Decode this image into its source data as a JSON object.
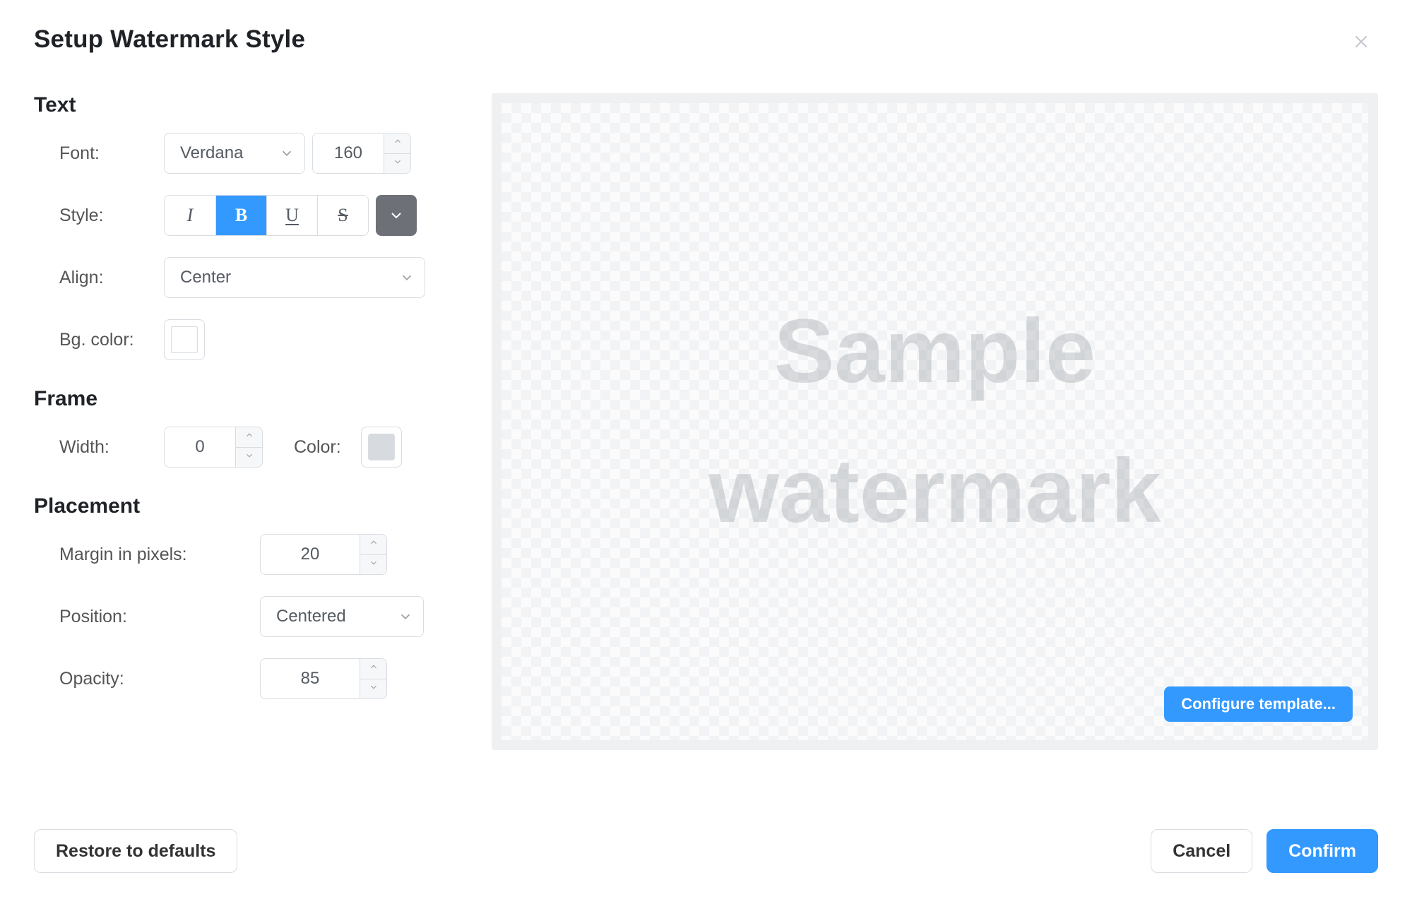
{
  "dialog": {
    "title": "Setup Watermark Style"
  },
  "sections": {
    "text": {
      "title": "Text",
      "font_label": "Font:",
      "font_value": "Verdana",
      "font_size": "160",
      "style_label": "Style:",
      "style_italic": "I",
      "style_bold": "B",
      "style_underline": "U",
      "style_strike": "S",
      "style_active": "bold",
      "text_color": "#6d7177",
      "align_label": "Align:",
      "align_value": "Center",
      "bgcolor_label": "Bg. color:",
      "bgcolor_value": "#ffffff"
    },
    "frame": {
      "title": "Frame",
      "width_label": "Width:",
      "width_value": "0",
      "color_label": "Color:",
      "color_value": "#d7dade"
    },
    "placement": {
      "title": "Placement",
      "margin_label": "Margin in pixels:",
      "margin_value": "20",
      "position_label": "Position:",
      "position_value": "Centered",
      "opacity_label": "Opacity:",
      "opacity_value": "85"
    }
  },
  "preview": {
    "watermark_text": "Sample\nwatermark",
    "configure_label": "Configure template..."
  },
  "footer": {
    "restore_label": "Restore to defaults",
    "cancel_label": "Cancel",
    "confirm_label": "Confirm"
  }
}
